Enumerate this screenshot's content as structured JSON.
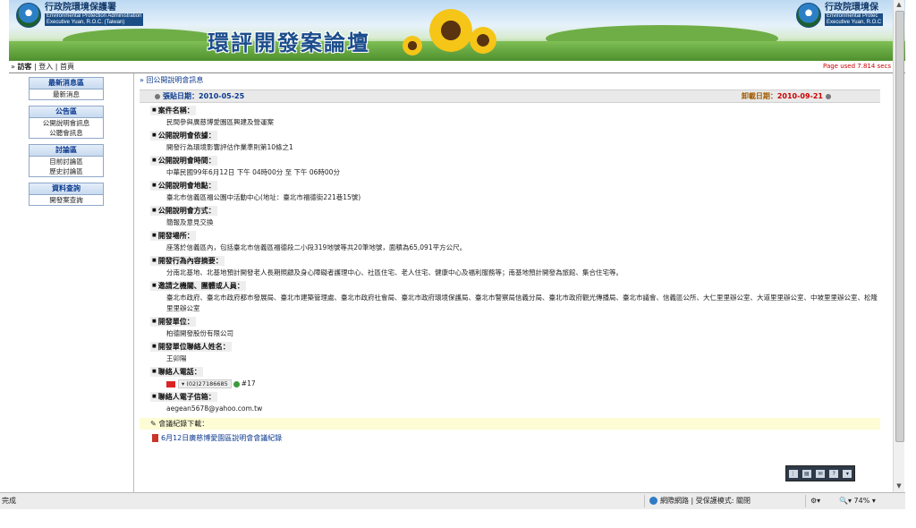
{
  "header": {
    "org_zh": "行政院環境保護署",
    "org_en_1": "Environmental Protection Administration",
    "org_en_2": "Executive Yuan, R.O.C. (Taiwan)",
    "right_org_zh": "行政院環境保",
    "right_org_en_1": "Environmental Protec",
    "right_org_en_2": "Executive Yuan, R.O.C",
    "site_title": "環評開發案論壇"
  },
  "nav": {
    "links": [
      "訪客",
      "登入",
      "首頁"
    ],
    "page_used": "Page used 7.814 secs"
  },
  "sidebar": [
    {
      "title": "最新消息區",
      "items": [
        "最新消息"
      ]
    },
    {
      "title": "公告區",
      "items": [
        "公開說明會訊息",
        "公聽會訊息"
      ]
    },
    {
      "title": "討論區",
      "items": [
        "目前討論區",
        "歷史討論區"
      ]
    },
    {
      "title": "資料查詢",
      "items": [
        "開發案查詢"
      ]
    }
  ],
  "main": {
    "back_link": "回公開說明會訊息",
    "post_date_label": "張貼日期：",
    "post_date": "2010-05-25",
    "delete_date_label": "卸載日期：",
    "delete_date": "2010-09-21",
    "fields": [
      {
        "label": "案件名稱：",
        "value": "民間參與廣慈博愛園區興建及營運案"
      },
      {
        "label": "公開說明會依據：",
        "value": "開發行為環境影響評估作業準則第10條之1"
      },
      {
        "label": "公開說明會時間：",
        "value": "中華民國99年6月12日 下午 04時00分 至 下午 06時00分"
      },
      {
        "label": "公開說明會地點：",
        "value": "臺北市信義區福公園中活動中心(地址：臺北市福德街221巷15號)"
      },
      {
        "label": "公開說明會方式：",
        "value": "簡報及意見交換"
      },
      {
        "label": "開發場所：",
        "value": "座落於信義區內，包括臺北市信義區福德段二小段319地號等共20筆地號，面積為65,091平方公尺。"
      },
      {
        "label": "開發行為內容摘要：",
        "value": "分南北基地、北基地預計開發老人長期照顧及身心障礙者護理中心、社區住宅、老人住宅、健康中心及福利服務等；南基地預計開發為旅館、集合住宅等。"
      },
      {
        "label": "邀請之機關、團體或人員：",
        "value": "臺北市政府、臺北市政府都市發展局、臺北市建築管理處、臺北市政府社會局、臺北市政府環境保護局、臺北市警察局信義分局、臺北市政府觀光傳播局、臺北市議會、信義區公所、大仁里里辦公室、大道里里辦公室、中坡里里辦公室、松隆里里辦公室"
      },
      {
        "label": "開發單位：",
        "value": "柏德開發股份有限公司"
      },
      {
        "label": "開發單位聯絡人姓名：",
        "value": "王卯陽"
      }
    ],
    "phone_label": "聯絡人電話：",
    "phone_number": "(02)27186685",
    "phone_ext": "#17",
    "email_label": "聯絡人電子信箱：",
    "email": "aegean5678@yahoo.com.tw",
    "record_label": "會議紀錄下載：",
    "record_link": "6月12日廣慈博愛園區說明會會議紀錄"
  },
  "statusbar": {
    "done": "完成",
    "zone": "網際網路 | 受保護模式: 關閉",
    "zoom": "74%"
  },
  "colors": {
    "link_blue": "#0b3a8e",
    "date_red": "#cc0000",
    "page_used_red": "#cc0000",
    "yellow_bar": "#fdfcd4"
  }
}
